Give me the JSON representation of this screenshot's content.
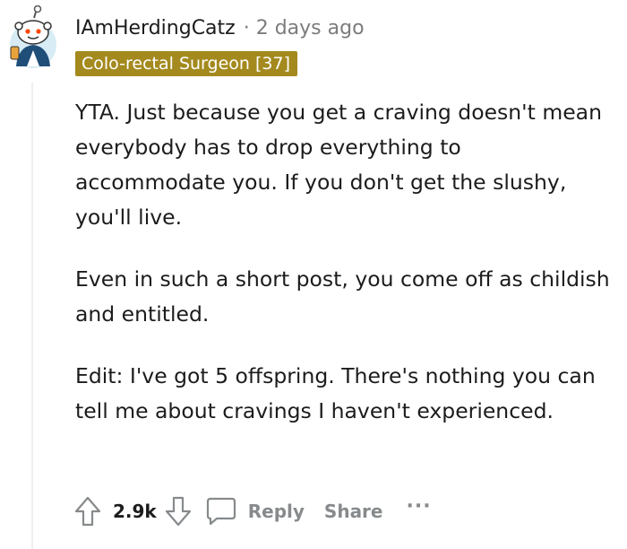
{
  "comment": {
    "username": "IAmHerdingCatz",
    "separator": "·",
    "timestamp": "2 days ago",
    "flair": "Colo-rectal Surgeon [37]",
    "paragraphs": [
      "YTA. Just because you get a craving doesn't mean everybody has to drop everything to accommodate you. If you don't get the slushy, you'll live.",
      "Even in such a short post, you come off as childish and entitled.",
      "Edit: I've got 5 offspring. There's nothing you can tell me about cravings I haven't experienced."
    ]
  },
  "actions": {
    "score": "2.9k",
    "reply_label": "Reply",
    "share_label": "Share",
    "more_label": "···"
  },
  "colors": {
    "flair_background": "#a48a1e",
    "flair_text": "#ffffff",
    "muted_text": "#7c7c7c",
    "action_text": "#878a8c"
  },
  "icons": {
    "avatar": "snoo-avatar-icon",
    "upvote": "arrow-up-icon",
    "downvote": "arrow-down-icon",
    "reply": "speech-bubble-icon"
  }
}
